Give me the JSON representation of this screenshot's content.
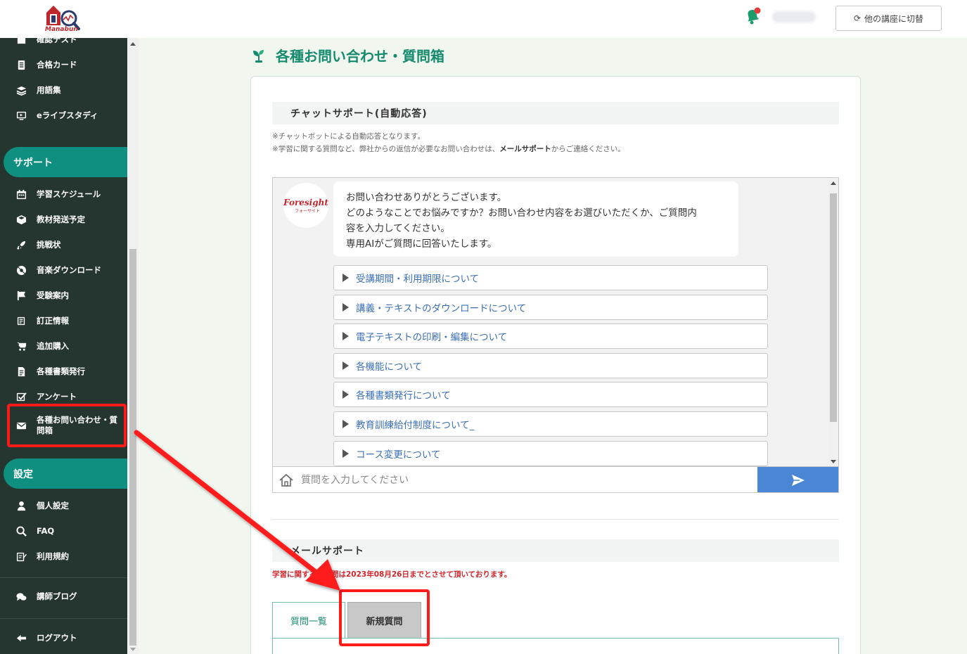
{
  "header": {
    "logo_text": "Manabun",
    "username": "",
    "switch_label": "他の講座に切替"
  },
  "sidebar": {
    "items_top": [
      {
        "label": "確認テスト",
        "icon": "puzzle-icon"
      },
      {
        "label": "合格カード",
        "icon": "card-icon"
      },
      {
        "label": "用語集",
        "icon": "book-stack-icon"
      },
      {
        "label": "eライブスタディ",
        "icon": "monitor-play-icon"
      }
    ],
    "support_head": "サポート",
    "support_items": [
      {
        "label": "学習スケジュール",
        "icon": "calendar-icon"
      },
      {
        "label": "教材発送予定",
        "icon": "box-icon"
      },
      {
        "label": "挑戦状",
        "icon": "rocket-icon"
      },
      {
        "label": "音楽ダウンロード",
        "icon": "music-disc-icon"
      },
      {
        "label": "受験案内",
        "icon": "flag-icon"
      },
      {
        "label": "訂正情報",
        "icon": "edit-list-icon"
      },
      {
        "label": "追加購入",
        "icon": "cart-icon"
      },
      {
        "label": "各種書類発行",
        "icon": "document-icon"
      },
      {
        "label": "アンケート",
        "icon": "checkbox-icon"
      },
      {
        "label": "各種お問い合わせ・質問箱",
        "icon": "mail-icon"
      }
    ],
    "settings_head": "設定",
    "settings_items": [
      {
        "label": "個人設定",
        "icon": "person-icon"
      },
      {
        "label": "FAQ",
        "icon": "search-icon"
      },
      {
        "label": "利用規約",
        "icon": "terms-icon"
      }
    ],
    "blog_label": "講師ブログ",
    "logout_label": "ログアウト"
  },
  "main": {
    "page_title": "各種お問い合わせ・質問箱",
    "chat_section_title": "チャットサポート(自動応答)",
    "chat_note_1": "※チャットボットによる自動応答となります。",
    "chat_note_2_pre": "※学習に関する質問など、弊社からの返信が必要なお問い合わせは、",
    "chat_note_2_bold": "メールサポート",
    "chat_note_2_post": "からご連絡ください。",
    "bot_name": "Foresight",
    "bot_sub": "フォーサイト",
    "bot_message": [
      "お問い合わせありがとうございます。",
      "どのようなことでお悩みですか？お問い合わせ内容をお選びいただくか、ご質問内",
      "容を入力してください。",
      "専用AIがご質問に回答いたします。"
    ],
    "options": [
      "受講期間・利用期限について",
      "講義・テキストのダウンロードについて",
      "電子テキストの印刷・編集について",
      "各機能について",
      "各種書類発行について",
      "教育訓練給付制度について_",
      "コース変更について"
    ],
    "chat_placeholder": "質問を入力してください",
    "mail_section_title": "メールサポート",
    "mail_note": "学習に関するご質問は2023年08月26日までとさせて頂いております。",
    "tabs": [
      "質問一覧",
      "新規質問"
    ]
  },
  "colors": {
    "sidebar_bg": "#25352f",
    "accent_teal": "#0e8f80",
    "title_green": "#168a6e",
    "send_blue": "#4a86d3",
    "highlight_red": "#ff1a1a"
  }
}
